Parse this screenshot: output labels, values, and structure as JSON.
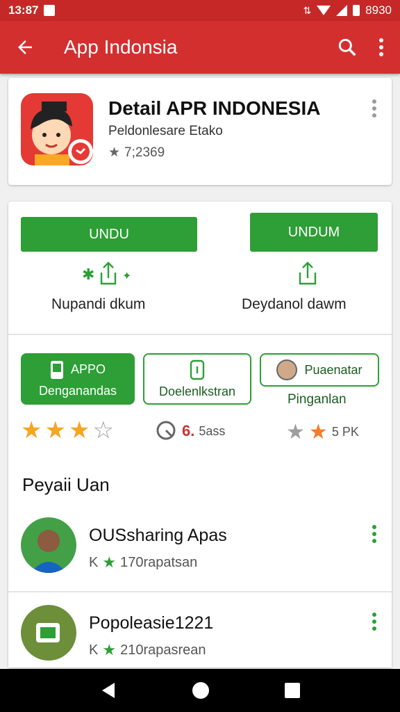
{
  "status": {
    "time": "13:87",
    "battery": "8930"
  },
  "appbar": {
    "title": "App Indonsia"
  },
  "app": {
    "title": "Detail APR INDONESIA",
    "subtitle": "Peldonlesare Etako",
    "rating": "7;2369"
  },
  "downloads": {
    "left": {
      "button": "UNDU",
      "label": "Nupandi dkum"
    },
    "right": {
      "button": "UNDUM",
      "label": "Deydanol dawm"
    }
  },
  "chips": [
    {
      "line1": "APPO",
      "line2": "Denganandas"
    },
    {
      "line1": "",
      "line2": "Doelenlkstran"
    },
    {
      "line1": "Puaenatar",
      "line2": ""
    }
  ],
  "chip_caption": "Pinganlan",
  "rating_row": {
    "stars_filled": 3,
    "stars_total": 4,
    "stat_mid_red": "6.",
    "stat_mid": "5ass",
    "stat_right": "5 PK"
  },
  "section": {
    "title": "Peyaii Uan"
  },
  "list": [
    {
      "title": "OUSsharing Apas",
      "prefix": "K",
      "sub": "170rapatsan"
    },
    {
      "title": "Popoleasie1221",
      "prefix": "K",
      "sub": "210rapasrean"
    }
  ],
  "colors": {
    "primary": "#d32f2f",
    "accent": "#2e9e36"
  }
}
